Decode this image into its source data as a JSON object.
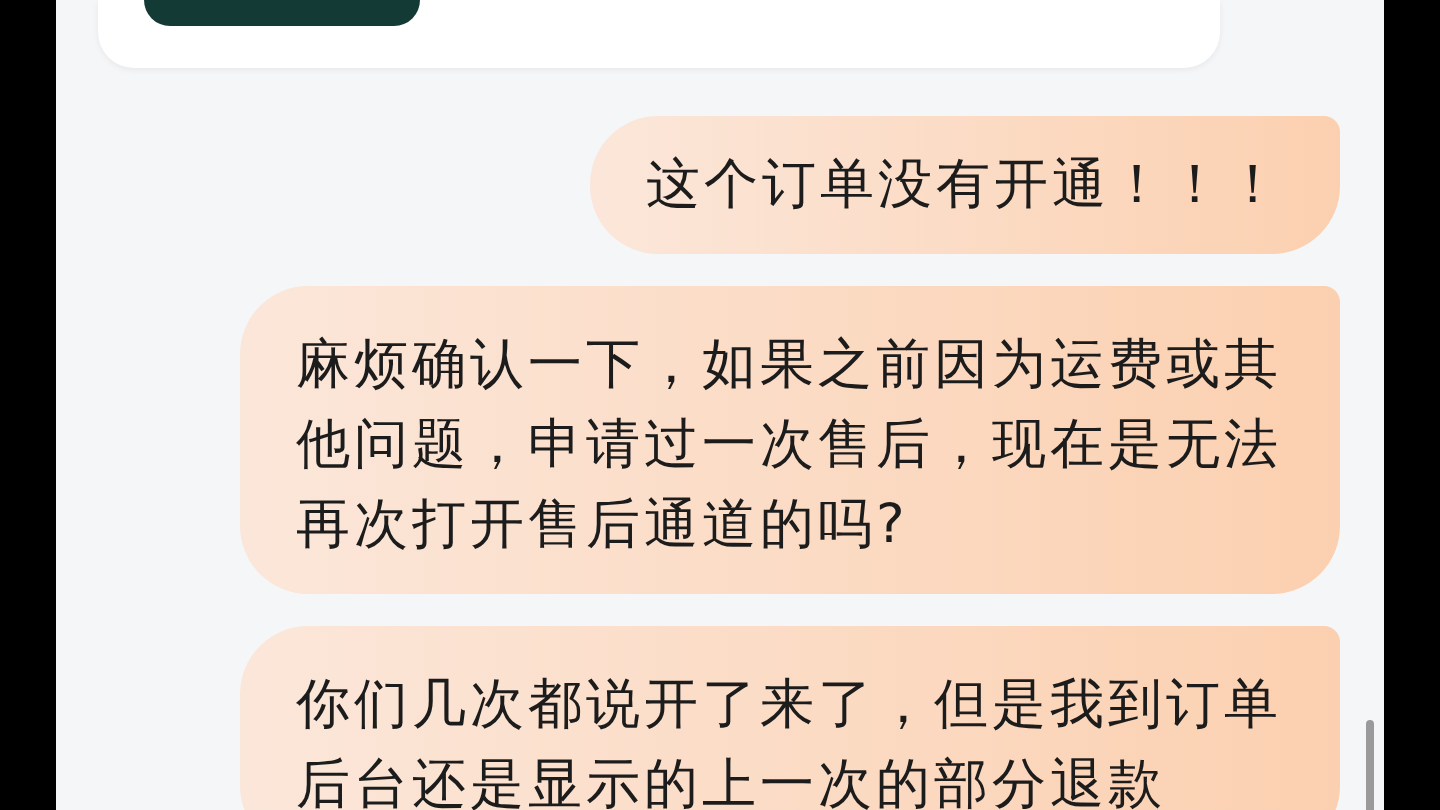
{
  "messages": [
    {
      "text": "这个订单没有开通！！！"
    },
    {
      "text": "麻烦确认一下，如果之前因为运费或其他问题，申请过一次售后，现在是无法再次打开售后通道的吗?"
    },
    {
      "text": "你们几次都说开了来了，但是我到订单后台还是显示的上一次的部分退款"
    }
  ]
}
